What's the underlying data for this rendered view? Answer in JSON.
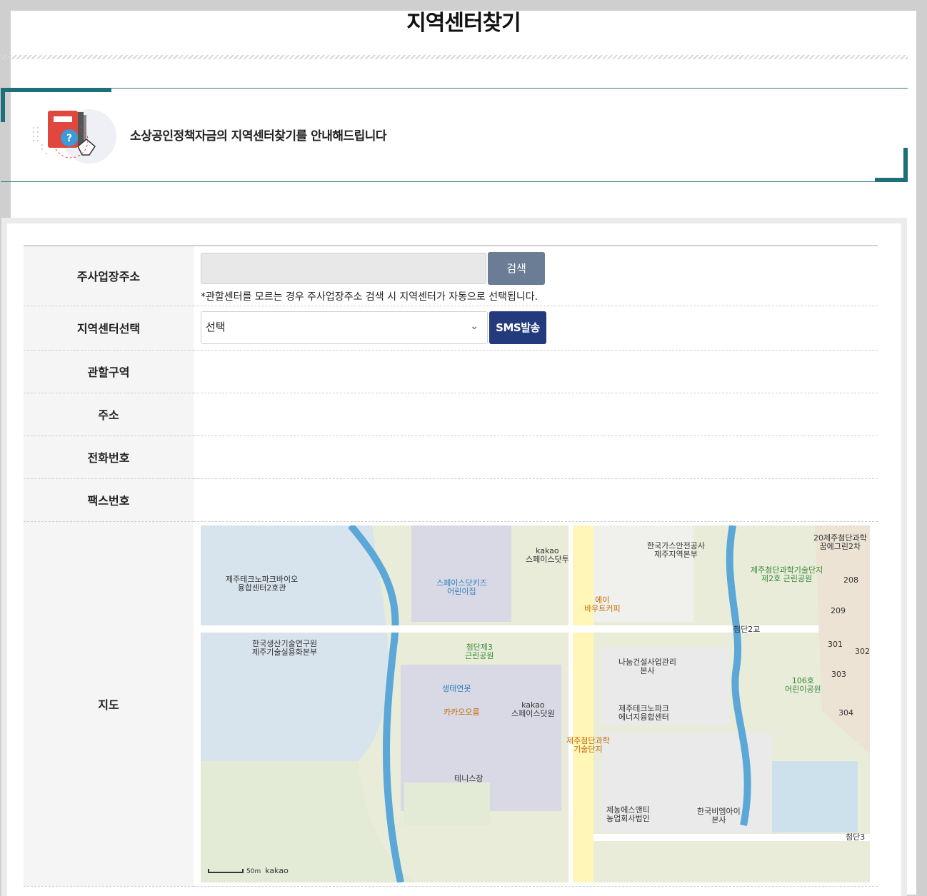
{
  "page": {
    "title": "지역센터찾기"
  },
  "intro": {
    "description": "소상공인정책자금의 지역센터찾기를 안내해드립니다"
  },
  "form": {
    "address": {
      "label": "주사업장주소",
      "input_value": "",
      "search_button": "검색",
      "note": "*관할센터를 모르는 경우 주사업장주소 검색 시 지역센터가 자동으로 선택됩니다."
    },
    "center": {
      "label": "지역센터선택",
      "selected": "선택",
      "sms_button": "SMS발송"
    },
    "jurisdiction": {
      "label": "관할구역",
      "value": ""
    },
    "addr": {
      "label": "주소",
      "value": ""
    },
    "phone": {
      "label": "전화번호",
      "value": ""
    },
    "fax": {
      "label": "팩스번호",
      "value": ""
    },
    "map": {
      "label": "지도"
    }
  },
  "map": {
    "labels": {
      "bio": "제주테크노파크바이오\n융합센터2호관",
      "kakao_spacedot_two": "kakao\n스페이스닷투",
      "gas": "한국가스안전공사\n제주지역본부",
      "cheomdan_park": "20제주첨단과학\n꿈에그린2차",
      "spacedot_kids": "스페이스닷키즈\n어린이집",
      "aybout": "에이\n바우트커피",
      "techpark2": "제주첨단과학기술단지\n제2호 근린공원",
      "park3": "첨단제3\n근린공원",
      "kitech": "한국생산기술연구원\n제주기술실용화본부",
      "bridge": "첨단2교",
      "nanum": "나눔건설사업관리\n본사",
      "ecopond": "생태연못",
      "kakao_orum": "카카오오름",
      "kakao_spacedot_one": "kakao\n스페이스닷원",
      "energy": "제주테크노파크\n에너지융합센터",
      "kids106": "106호\n어린이공원",
      "science": "제주첨단과학\n기술단지",
      "tennis": "테니스장",
      "nongup": "제농에스앤티\n농업회사법인",
      "bmi": "한국비엠아이\n본사",
      "cheomdan3": "첨단3",
      "n208": "208",
      "n209": "209",
      "n301": "301",
      "n302": "302",
      "n303": "303",
      "n304": "304"
    },
    "scale_label": "50m",
    "brand": "kakao"
  }
}
